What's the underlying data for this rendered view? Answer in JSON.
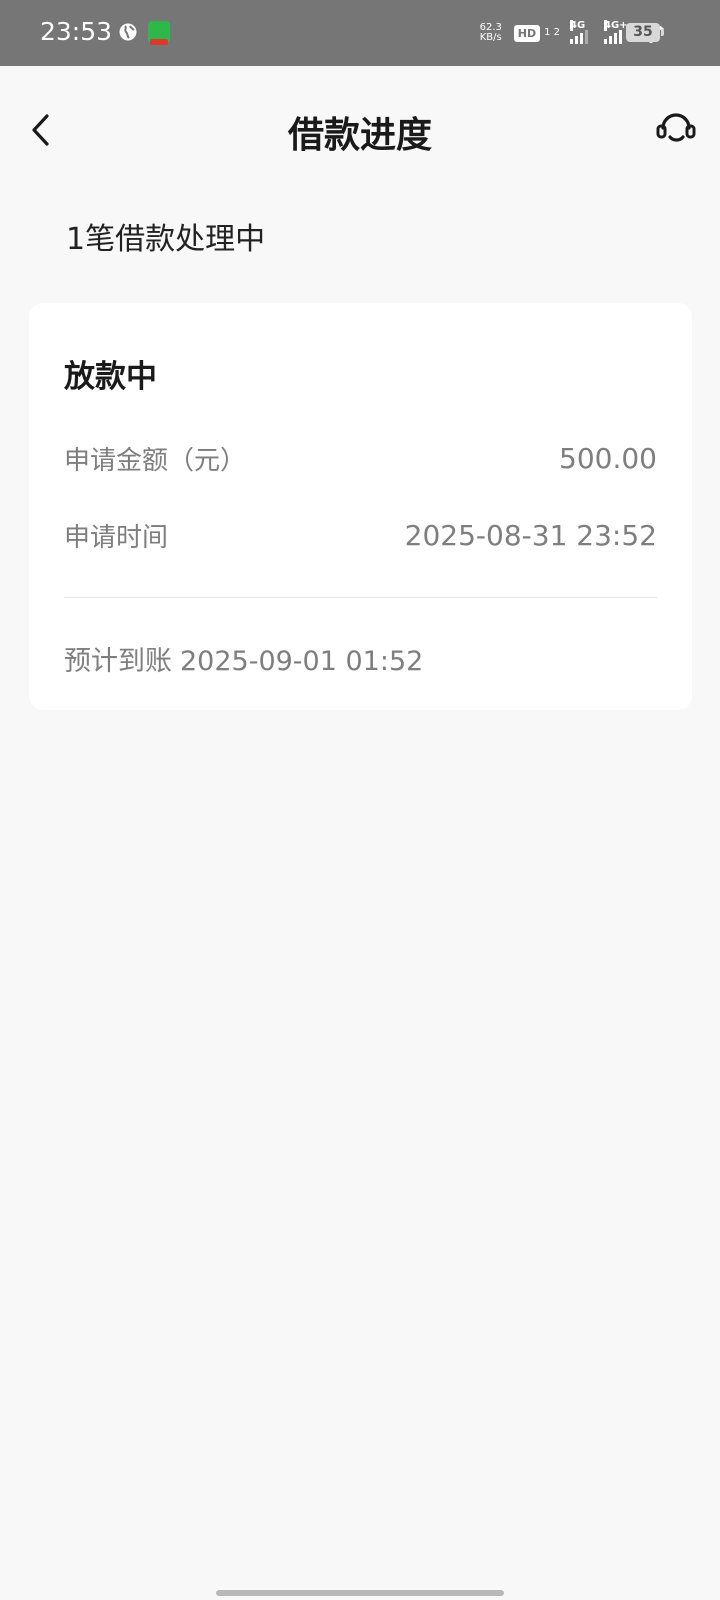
{
  "status_bar": {
    "time": "23:53",
    "net_speed_value": "62.3",
    "net_speed_unit": "KB/s",
    "hd_label": "HD",
    "hd_sub": "1 2",
    "sim1_label": "4G",
    "sim2_label": "4G+",
    "battery": "35"
  },
  "nav": {
    "title": "借款进度",
    "back_icon": "chevron-left-icon",
    "service_icon": "headset-icon"
  },
  "summary": "1笔借款处理中",
  "loan_card": {
    "status": "放款中",
    "amount_label": "申请金额（元）",
    "amount_value": "500.00",
    "time_label": "申请时间",
    "time_value": "2025-08-31 23:52",
    "eta_label": "预计到账",
    "eta_value": "2025-09-01 01:52"
  },
  "colors": {
    "background": "#f8f8f8",
    "card": "#ffffff",
    "status_bar": "#767676",
    "primary_text": "#1a1a1a",
    "secondary_text": "#7e7e7e"
  }
}
